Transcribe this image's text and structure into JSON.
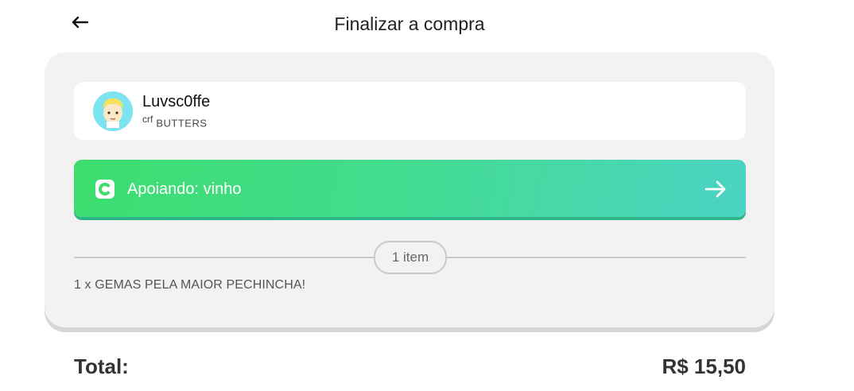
{
  "header": {
    "title": "Finalizar a compra"
  },
  "profile": {
    "username": "Luvsc0ffe",
    "prefix": "crf",
    "display_name": "BUTTERS"
  },
  "support": {
    "label": "Apoiando: vinho"
  },
  "items": {
    "count_label": "1 item",
    "lines": [
      "1 x GEMAS PELA MAIOR PECHINCHA!"
    ]
  },
  "total": {
    "label": "Total:",
    "value": "R$ 15,50"
  },
  "icons": {
    "back": "arrow-left-icon",
    "support_logo": "ko-fi-c-logo-icon",
    "support_arrow": "arrow-right-icon"
  },
  "colors": {
    "gradient_start": "#3ddd6e",
    "gradient_end": "#4bd3c4",
    "card_bg": "#f2f2f2"
  }
}
